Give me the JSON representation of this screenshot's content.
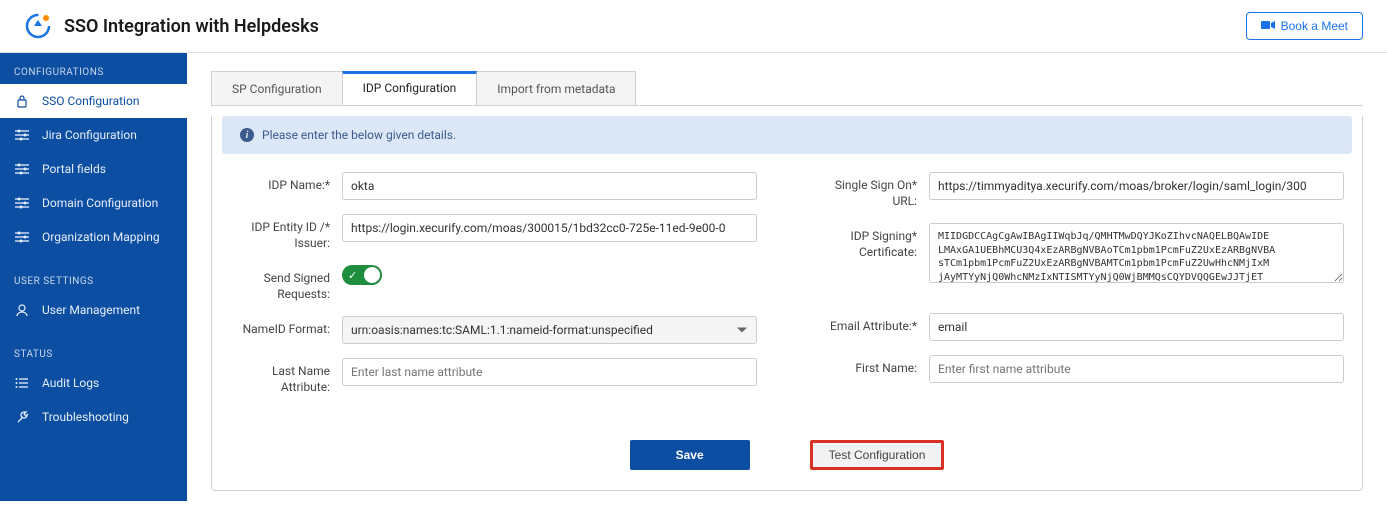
{
  "header": {
    "title": "SSO Integration with Helpdesks",
    "book_meet_label": "Book a Meet"
  },
  "sidebar": {
    "sections": [
      {
        "label": "CONFIGURATIONS",
        "items": [
          {
            "label": "SSO Configuration",
            "icon": "lock-icon",
            "active": true
          },
          {
            "label": "Jira Configuration",
            "icon": "settings-icon",
            "active": false
          },
          {
            "label": "Portal fields",
            "icon": "settings-icon",
            "active": false
          },
          {
            "label": "Domain Configuration",
            "icon": "settings-icon",
            "active": false
          },
          {
            "label": "Organization Mapping",
            "icon": "settings-icon",
            "active": false
          }
        ]
      },
      {
        "label": "USER SETTINGS",
        "items": [
          {
            "label": "User Management",
            "icon": "user-icon",
            "active": false
          }
        ]
      },
      {
        "label": "STATUS",
        "items": [
          {
            "label": "Audit Logs",
            "icon": "list-icon",
            "active": false
          },
          {
            "label": "Troubleshooting",
            "icon": "wrench-icon",
            "active": false
          }
        ]
      }
    ]
  },
  "tabs": [
    {
      "label": "SP Configuration",
      "active": false
    },
    {
      "label": "IDP Configuration",
      "active": true
    },
    {
      "label": "Import from metadata",
      "active": false
    }
  ],
  "info_message": "Please enter the below given details.",
  "form": {
    "idp_name": {
      "label": "IDP Name:*",
      "value": "okta"
    },
    "idp_entity": {
      "label": "IDP Entity ID /* Issuer:",
      "value": "https://login.xecurify.com/moas/300015/1bd32cc0-725e-11ed-9e00-0"
    },
    "send_signed": {
      "label": "Send Signed Requests:",
      "checked": true
    },
    "nameid_format": {
      "label": "NameID Format:",
      "value": "urn:oasis:names:tc:SAML:1.1:nameid-format:unspecified"
    },
    "last_name": {
      "label": "Last Name Attribute:",
      "value": "",
      "placeholder": "Enter last name attribute"
    },
    "sso_url": {
      "label": "Single Sign On* URL:",
      "value": "https://timmyaditya.xecurify.com/moas/broker/login/saml_login/300"
    },
    "idp_signing": {
      "label": "IDP Signing* Certificate:",
      "value": "MIIDGDCCAgCgAwIBAgIIWqbJq/QMHTMwDQYJKoZIhvcNAQELBQAwIDE\nLMAxGA1UEBhMCU3Q4xEzARBgNVBAoTCm1pbm1PcmFuZ2UxEzARBgNVBA\nsTCm1pbm1PcmFuZ2UxEzARBgNVBAMTCm1pbm1PcmFuZ2UwHhcNMjIxM\njAyMTYyNjQ0WhcNMzIxNTISMTYyNjQ0WjBMMQsCQYDVQQGEwJJTjET"
    },
    "email_attr": {
      "label": "Email Attribute:*",
      "value": "email"
    },
    "first_name": {
      "label": "First Name:",
      "value": "",
      "placeholder": "Enter first name attribute"
    }
  },
  "actions": {
    "save": "Save",
    "test": "Test Configuration"
  }
}
